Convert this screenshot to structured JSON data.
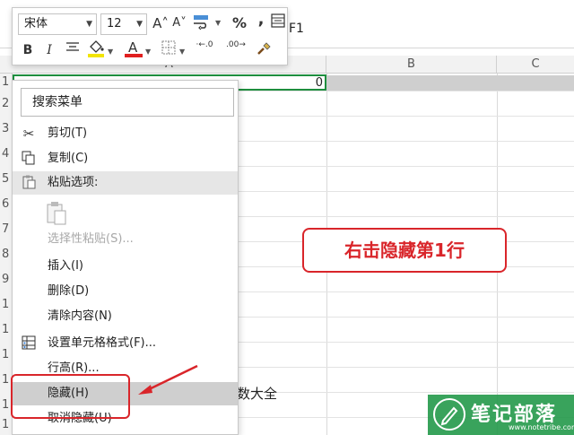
{
  "formula_bar": {
    "content": "F1"
  },
  "columns": [
    "A",
    "B",
    "C"
  ],
  "row_numbers": [
    "1",
    "2",
    "3",
    "4",
    "5",
    "6",
    "7",
    "8",
    "9",
    "1",
    "1",
    "1",
    "1",
    "1",
    "1",
    "1"
  ],
  "cell_a1_value": "0",
  "partial_cell_text": "数大全",
  "mini_toolbar": {
    "font_name": "宋体",
    "font_size": "12",
    "grow_font": "A˄",
    "shrink_font": "A˅",
    "percent": "%",
    "comma": ",",
    "bold": "B",
    "italic": "I",
    "font_color_letter": "A",
    "increase_decimal": "·←.0",
    "decrease_decimal": ".00→"
  },
  "context_menu": {
    "search_placeholder": "搜索菜单",
    "items": {
      "cut": "剪切(T)",
      "copy": "复制(C)",
      "paste_options": "粘贴选项:",
      "paste_special": "选择性粘贴(S)...",
      "insert": "插入(I)",
      "delete": "删除(D)",
      "clear": "清除内容(N)",
      "format_cells": "设置单元格格式(F)...",
      "row_height": "行高(R)...",
      "hide": "隐藏(H)",
      "unhide": "取消隐藏(U)"
    }
  },
  "callout": {
    "text": "右击隐藏第1行"
  },
  "watermark": {
    "text": "笔记部落",
    "sub": "www.notetribe.com"
  },
  "colors": {
    "accent_red": "#d9252a",
    "selection_green": "#1e8e3e",
    "watermark_green": "#1e9646"
  }
}
